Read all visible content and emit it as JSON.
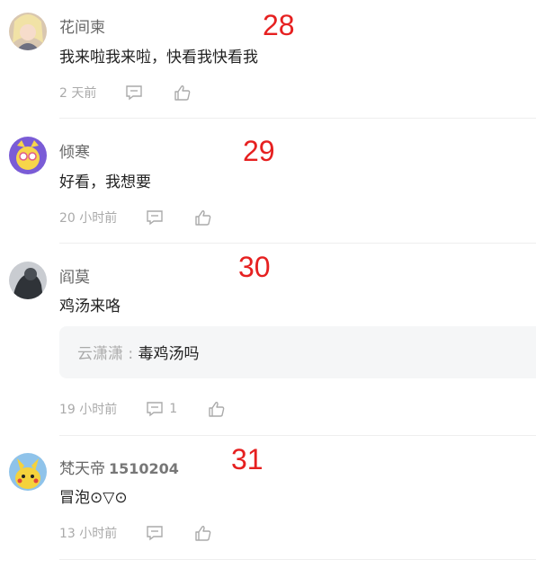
{
  "comments": [
    {
      "annotation": "28",
      "username": "花间柬",
      "username_extra": "",
      "text": "我来啦我来啦，快看我快看我",
      "time": "2 天前",
      "reply_count": ""
    },
    {
      "annotation": "29",
      "username": "倾寒",
      "username_extra": "",
      "text": "好看，我想要",
      "time": "20 小时前",
      "reply_count": ""
    },
    {
      "annotation": "30",
      "username": "阎莫",
      "username_extra": "",
      "text": "鸡汤来咯",
      "time": "19 小时前",
      "reply_count": "1",
      "sub_reply": {
        "user": "云潇潇 : ",
        "text": "毒鸡汤吗"
      }
    },
    {
      "annotation": "31",
      "username": "梵天帝",
      "username_extra": "1510204",
      "text": "冒泡⊙▽⊙",
      "time": "13 小时前",
      "reply_count": ""
    }
  ],
  "colors": {
    "annotation": "#e62020",
    "meta_text": "#aaaaaa",
    "divider": "#eeeeee",
    "subreply_bg": "#f5f6f7"
  },
  "icons": [
    "reply-icon",
    "like-icon"
  ]
}
